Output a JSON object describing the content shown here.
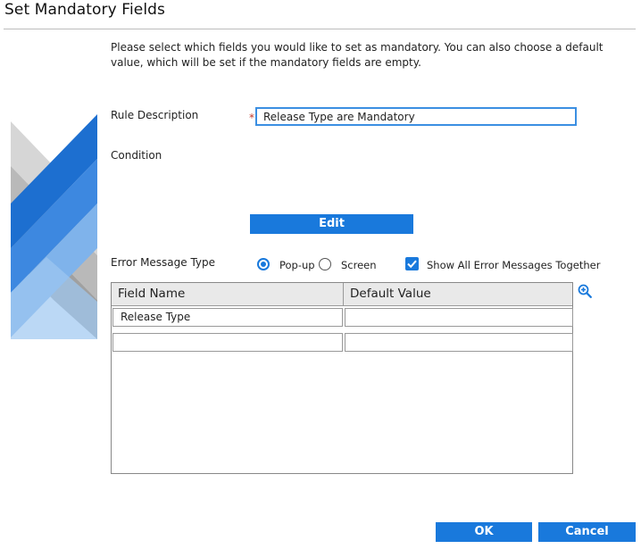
{
  "dialog": {
    "title": "Set Mandatory Fields",
    "intro": "Please select which fields you would like to set as mandatory. You can also choose a default value, which will be set if the mandatory fields are empty."
  },
  "form": {
    "rule_description_label": "Rule Description",
    "required_marker": "*",
    "rule_description_value": "Release Type are Mandatory",
    "condition_label": "Condition",
    "edit_label": "Edit",
    "error_message_type_label": "Error Message Type",
    "popup_label": "Pop-up",
    "popup_selected": true,
    "screen_label": "Screen",
    "screen_selected": false,
    "show_all_label": "Show All Error Messages Together",
    "show_all_checked": true
  },
  "grid": {
    "columns": [
      "Field Name",
      "Default Value"
    ],
    "rows": [
      [
        "Release Type",
        ""
      ],
      [
        "",
        ""
      ]
    ]
  },
  "footer": {
    "ok_label": "OK",
    "cancel_label": "Cancel"
  },
  "colors": {
    "accent": "#1979dc",
    "required": "#c0392b"
  },
  "icons": {
    "zoom": "zoom-in-icon",
    "checkbox": "check-icon"
  }
}
